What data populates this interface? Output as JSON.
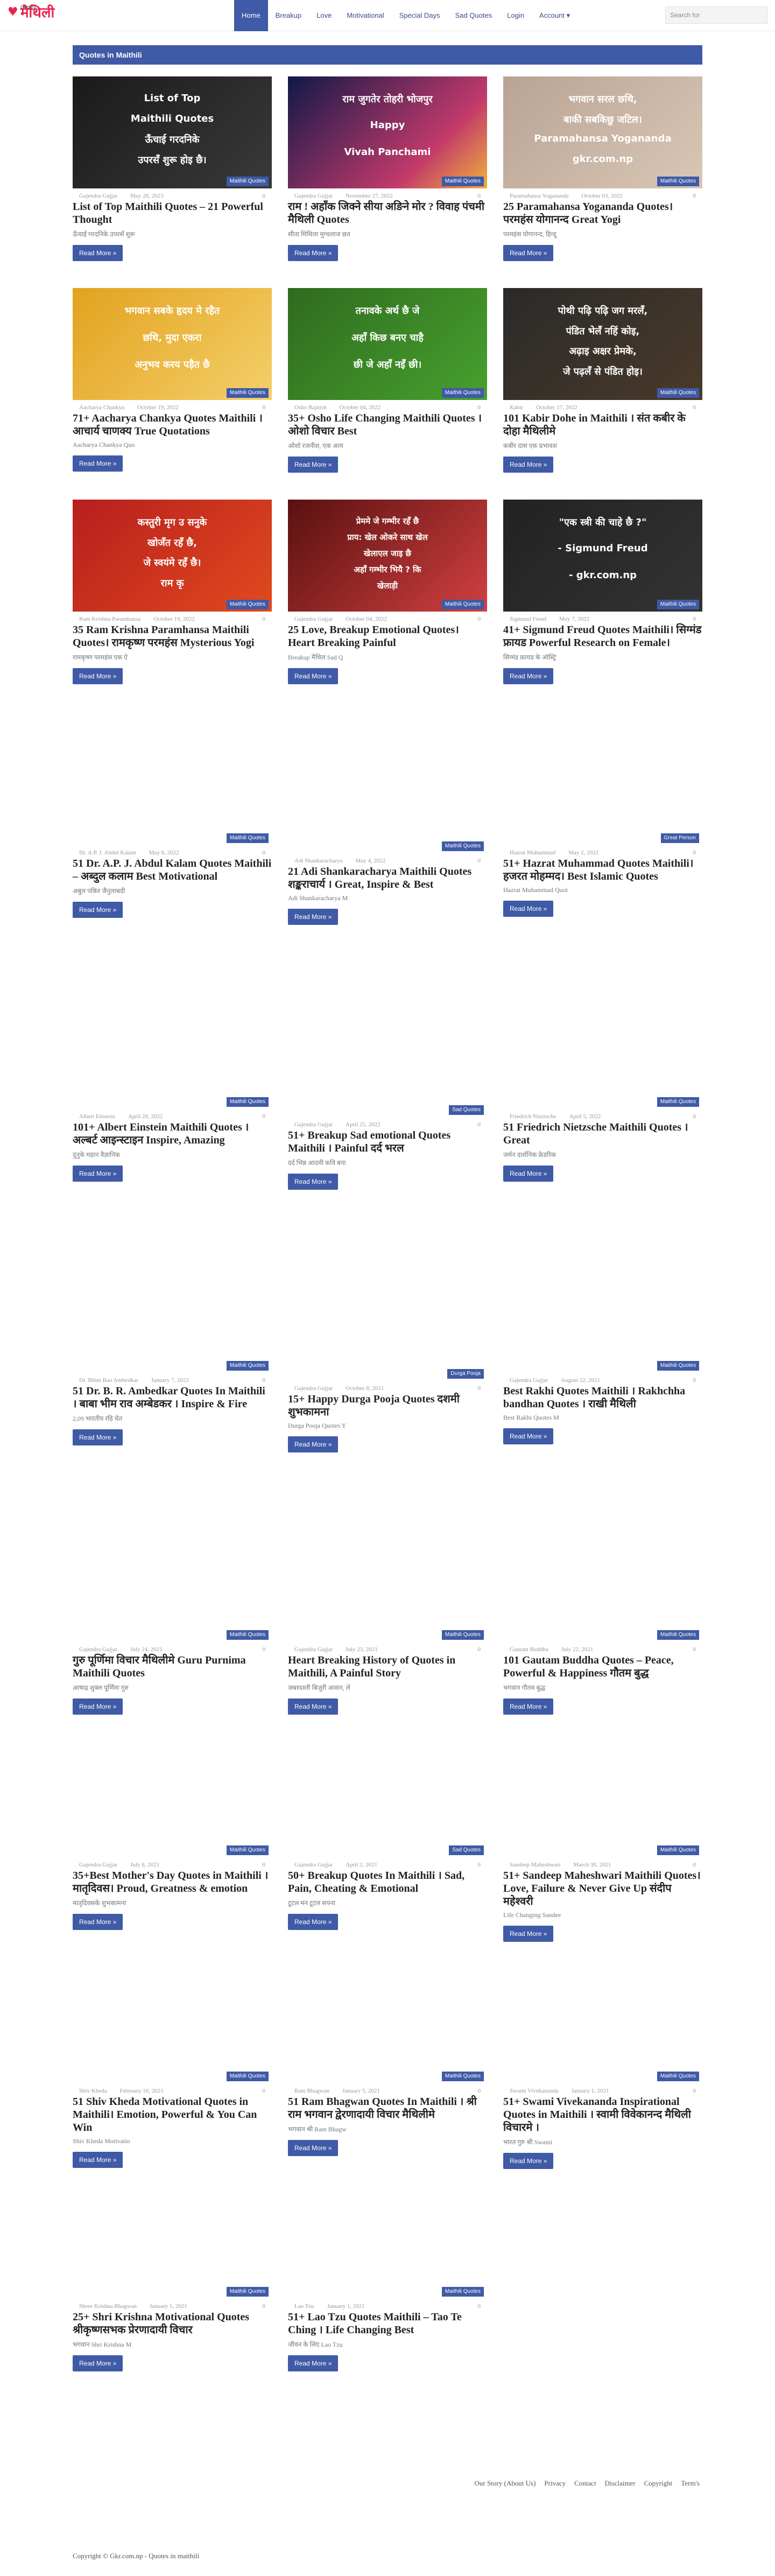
{
  "brand": {
    "logo_text": "मैथिली",
    "logo_sub": "Quotes"
  },
  "menu": [
    {
      "label": "Home"
    },
    {
      "label": "Breakup"
    },
    {
      "label": "Love"
    },
    {
      "label": "Motivational"
    },
    {
      "label": "Special Days"
    },
    {
      "label": "Sad Quotes"
    },
    {
      "label": "Login"
    },
    {
      "label": "Account ▾"
    }
  ],
  "search": {
    "placeholder": "Search for"
  },
  "section_title": "Quotes in Maithili",
  "read_more": "Read More »",
  "thumb_text": {
    "c1": {
      "line1": "List of Top",
      "line2": "Maithili Quotes",
      "line3": "ऊँचाई गरदनिके",
      "line4": "उपरसँ शुरू होइ छै।"
    },
    "c2": {
      "line1": "राम जुगतेर तोहरी भोजपुर",
      "line2": "Happy",
      "line3": "Vivah Panchami"
    },
    "c3": {
      "line1": "भगवान सरल छथि,",
      "line2": "बाकी सबकिछु जटिल।",
      "line3": "Paramahansa Yogananda",
      "line4": "gkr.com.np"
    },
    "c4": {
      "line1": "भगवान सबके हृदय मे रहैत",
      "line2": "छथि, मुदा एकरा",
      "line3": "अनुभव करय पड़ैत छै"
    },
    "c5": {
      "line1": "तनावके अर्थ छै जे",
      "line2": "अहाँ किछ बनए चाहै",
      "line3": "छी जे अहाँ नइँ छी।"
    },
    "c6": {
      "line1": "पोथी पढ़ि पढ़ि जग मरलँ,",
      "line2": "पंडित भेलँ नहिं कोइ,",
      "line3": "अढ़ाइ अक्षर प्रेमके,",
      "line4": "जे पढ़लँ से पंडित होइ।"
    },
    "c7": {
      "line1": "कस्तुरी मृग उ सनुके",
      "line2": "खोजँत रहँ छै,",
      "line3": "जे स्वयंमे रहँ छै।",
      "line4": "राम कृ"
    },
    "c8": {
      "line1": "प्रेममे जे गम्भीर रहँ छै",
      "line2": "प्राय: खेल ओकरे साथ खेल",
      "line3": "खेलाएल जाइ छै",
      "line4": "अहाँ गम्भीर भियै ? कि",
      "line5": "खेलाड़ी"
    },
    "c9": {
      "line1": "\"एक स्त्री की चाहे छै ?\"",
      "line2": "- Sigmund Freud",
      "line3": "- gkr.com.np"
    }
  },
  "cards": [
    {
      "cat": "Maithili Quotes",
      "author": "Gajendra Gujjar",
      "date": "May 26, 2023",
      "count": "0",
      "title": "List of Top Maithili Quotes – 21 Powerful Thought",
      "excerpt": "ऊँचाई गरदनिके उपरसँ शुरू"
    },
    {
      "cat": "Maithili Quotes",
      "author": "Gajendra Gujjar",
      "date": "November 27, 2022",
      "count": "0",
      "title": "राम ! अहाँक जिक्ने सीया अङिने मोर ? विवाह पंचमी मैथिली Quotes",
      "excerpt": "सीता मिथिला मुग्धलाज छत"
    },
    {
      "cat": "Maithili Quotes",
      "author": "Paramahansa Yogananda",
      "date": "October 03, 2022",
      "count": "0",
      "title": "25 Paramahansa Yogananda Quotes। परमहंस योगानन्द Great Yogi",
      "excerpt": "परमहंस योगानन्द, हिन्दू"
    },
    {
      "cat": "Maithili Quotes",
      "author": "Aacharya Chankya",
      "date": "October 19, 2022",
      "count": "0",
      "title": "71+ Aacharya Chankya Quotes Maithili । आचार्य चाणक्य True Quotations",
      "excerpt": "Aacharya Chankya Quo"
    },
    {
      "cat": "Maithili Quotes",
      "author": "Osho Rajnish",
      "date": "October 04, 2022",
      "count": "0",
      "title": "35+ Osho Life Changing Maithili Quotes । ओशो विचार Best",
      "excerpt": "ओशो रजनीश, एक अत्य"
    },
    {
      "cat": "Maithili Quotes",
      "author": "Kabir",
      "date": "October 17, 2022",
      "count": "0",
      "title": "101 Kabir Dohe in Maithili । संत कबीर के दोहा मैथिलीमे",
      "excerpt": "कबीर दास एक प्रभावश"
    },
    {
      "cat": "Maithili Quotes",
      "author": "Ram Krishna Paramhansa",
      "date": "October 19, 2022",
      "count": "0",
      "title": "35 Ram Krishna Paramhansa Maithili Quotes। रामकृष्ण परमहंस Mysterious Yogi",
      "excerpt": "रामकृष्ण परमहंस एक ऐ"
    },
    {
      "cat": "Maithili Quotes",
      "author": "Gajendra Gujjar",
      "date": "October 04, 2022",
      "count": "0",
      "title": "25 Love, Breakup Emotional Quotes। Heart Breaking Painful",
      "excerpt": "Breakup मैथिल Sad Q"
    },
    {
      "cat": "Maithili Quotes",
      "author": "Sigmund Freud",
      "date": "May 7, 2022",
      "count": "0",
      "title": "41+ Sigmund Freud Quotes Maithili। सिग्मंड फ्रायड Powerful Research on Female।",
      "excerpt": "सिग्मंड फ्रायड के ऑस्ट्रि"
    },
    {
      "cat": "Maithili Quotes",
      "author": "Dr. A.P. J. Abdul Kalam",
      "date": "May 6, 2022",
      "count": "0",
      "title": "51 Dr. A.P. J. Abdul Kalam Quotes Maithili – अब्दुल कलाम Best Motivational",
      "excerpt": "अबुल पकिर जैनुलाबदी"
    },
    {
      "cat": "Maithili Quotes",
      "author": "Adi Shankaracharya",
      "date": "May 4, 2022",
      "count": "0",
      "title": "21 Adi Shankaracharya Maithili Quotes शङ्कराचार्य । Great, Inspire & Best",
      "excerpt": "Adi Shankaracharya M"
    },
    {
      "cat": "Great Person",
      "author": "Hazrat Muhammad",
      "date": "May 2, 2022",
      "count": "0",
      "title": "51+ Hazrat Muhammad Quotes Maithili। हजरत मोहम्मद। Best Islamic Quotes",
      "excerpt": "Hazrat Muhammad Quot"
    },
    {
      "cat": "Maithili Quotes",
      "author": "Albert Einstein",
      "date": "April 28, 2022",
      "count": "0",
      "title": "101+ Albert Einstein Maithili Quotes । अल्बर्ट आइन्स्टाइन Inspire, Amazing",
      "excerpt": "दुनुके महान वैज्ञानिक"
    },
    {
      "cat": "Sad Quotes",
      "author": "Gajendra Gujjar",
      "date": "April 25, 2022",
      "count": "0",
      "title": "51+ Breakup Sad emotional Quotes Maithili । Painful दर्द भरल",
      "excerpt": "दर्द भिन्न आदमी कवि बना"
    },
    {
      "cat": "Maithili Quotes",
      "author": "Friedrich Nietzsche",
      "date": "April 5, 2022",
      "count": "0",
      "title": "51 Friedrich Nietzsche Maithili Quotes । Great",
      "excerpt": "जर्मन दार्शनिक फ्रेडरिक"
    },
    {
      "cat": "Maithili Quotes",
      "author": "Dr. Bhim Rao Ambedkar",
      "date": "January 7, 2022",
      "count": "0",
      "title": "51 Dr. B. R. Ambedkar Quotes In Maithili । बाबा भीम राव अम्बेडकर । Inspire & Fire",
      "excerpt": "2,09 भारतीय रहि चेत"
    },
    {
      "cat": "Durga Pooja",
      "author": "Gajendra Gujjar",
      "date": "October 8, 2021",
      "count": "0",
      "title": "15+ Happy Durga Pooja Quotes दशमी शुभकामना",
      "excerpt": "Durga Pooja Quotes Y"
    },
    {
      "cat": "Maithili Quotes",
      "author": "Gajendra Gujjar",
      "date": "August 22, 2021",
      "count": "0",
      "title": "Best Rakhi Quotes Maithili । Rakhchha bandhan Quotes । राखी मैथिली",
      "excerpt": "Best Rakhi Quotes M"
    },
    {
      "cat": "Maithili Quotes",
      "author": "Gajendra Gujjar",
      "date": "July 24, 2021",
      "count": "0",
      "title": "गुरु पूर्णिमा विचार मैथिलीमे Guru Purnima Maithili Quotes",
      "excerpt": "आषाढ़ शुक्ल पूर्णिमा गुरु"
    },
    {
      "cat": "Maithili Quotes",
      "author": "Gajendra Gujjar",
      "date": "July 23, 2021",
      "count": "0",
      "title": "Heart Breaking History of Quotes in Maithili, A Painful Story",
      "excerpt": "जबरदस्ती बिजुरी आसन, ले"
    },
    {
      "cat": "Maithili Quotes",
      "author": "Gautam Buddha",
      "date": "July 22, 2021",
      "count": "0",
      "title": "101 Gautam Buddha Quotes – Peace, Powerful & Happiness गौतम बुद्ध",
      "excerpt": "भगवान गौतम बुद्ध"
    },
    {
      "cat": "Maithili Quotes",
      "author": "Gajendra Gujjar",
      "date": "July 8, 2021",
      "count": "0",
      "title": "35+Best Mother's Day Quotes in Maithili । मातृदिवस। Proud, Greatness & emotion",
      "excerpt": "मातृदिवसके शुभकामना"
    },
    {
      "cat": "Sad Quotes",
      "author": "Gajendra Gujjar",
      "date": "April 2, 2021",
      "count": "0",
      "title": "50+ Breakup Quotes In Maithili । Sad, Pain, Cheating & Emotional",
      "excerpt": "टूटल मन टूटल सपना"
    },
    {
      "cat": "Maithili Quotes",
      "author": "Sandeep Maheshwari",
      "date": "March 30, 2021",
      "count": "0",
      "title": "51+ Sandeep Maheshwari Maithili Quotes। Love, Failure & Never Give Up संदीप महेश्वरी",
      "excerpt": "Life Changing Sandee"
    },
    {
      "cat": "Maithili Quotes",
      "author": "Shiv Kheda",
      "date": "February 16, 2021",
      "count": "0",
      "title": "51 Shiv Kheda Motivational Quotes in Maithili। Emotion, Powerful & You Can Win",
      "excerpt": "Shiv Kheda Motivatio"
    },
    {
      "cat": "Maithili Quotes",
      "author": "Ram Bhagwan",
      "date": "January 5, 2021",
      "count": "0",
      "title": "51 Ram Bhagwan Quotes In Maithili । श्री राम भगवान द्वेरणादायी विचार मैथिलीमे",
      "excerpt": "भगवान श्री Ram Bhagw"
    },
    {
      "cat": "Maithili Quotes",
      "author": "Swami Vivekananda",
      "date": "January 1, 2021",
      "count": "0",
      "title": "51+ Swami Vivekananda Inspirational Quotes in Maithili । स्वामी विवेकानन्द मैथिली विचारमे ।",
      "excerpt": "भारत गुरु श्री Swami"
    },
    {
      "cat": "Maithili Quotes",
      "author": "Shree Krishna Bhagwan",
      "date": "January 1, 2021",
      "count": "0",
      "title": "25+ Shri Krishna Motivational Quotes श्रीकृष्णसभक प्रेरणादायी विचार",
      "excerpt": "भगवान Shri Krishna M"
    },
    {
      "cat": "Maithili Quotes",
      "author": "Lao Tzu",
      "date": "January 1, 2021",
      "count": "0",
      "title": "51+ Lao Tzu Quotes Maithili – Tao Te Ching । Life Changing Best",
      "excerpt": "जीवन के लिए Lao Tzu"
    }
  ],
  "footer": {
    "links": [
      "Our Story (About Us)",
      "Privacy",
      "Contact",
      "Disclaimer",
      "Copyright",
      "Term's"
    ],
    "copyright": "Copyright © Gkr.com.np - Quotes in maithili"
  }
}
